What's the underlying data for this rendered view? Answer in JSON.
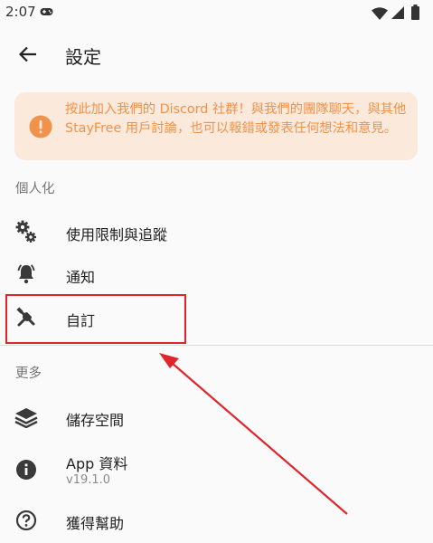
{
  "status_bar": {
    "time": "2:07",
    "icons": [
      "gamepad-icon",
      "wifi-icon",
      "cellular-icon",
      "battery-icon"
    ]
  },
  "app_bar": {
    "title": "設定",
    "back_icon": "arrow-left-icon"
  },
  "banner": {
    "text": "按此加入我們的 Discord 社群！與我們的團隊聊天，與其他 StayFree 用戶討論，也可以報錯或發表任何想法和意見。",
    "icon": "exclamation-circle-icon",
    "accent_color": "#f0924a",
    "background_color": "#fbe9dc"
  },
  "sections": {
    "personalization": {
      "header": "個人化",
      "items": [
        {
          "label": "使用限制與追蹤",
          "icon": "gears-icon"
        },
        {
          "label": "通知",
          "icon": "bell-icon"
        },
        {
          "label": "自訂",
          "icon": "tools-icon"
        }
      ]
    },
    "more": {
      "header": "更多",
      "items": [
        {
          "label": "儲存空間",
          "icon": "layers-icon"
        },
        {
          "label": "App 資料",
          "subtitle": "v19.1.0",
          "icon": "info-circle-icon"
        },
        {
          "label": "獲得幫助",
          "icon": "help-circle-icon"
        }
      ]
    }
  },
  "annotation": {
    "highlight_color": "#e0242b"
  }
}
